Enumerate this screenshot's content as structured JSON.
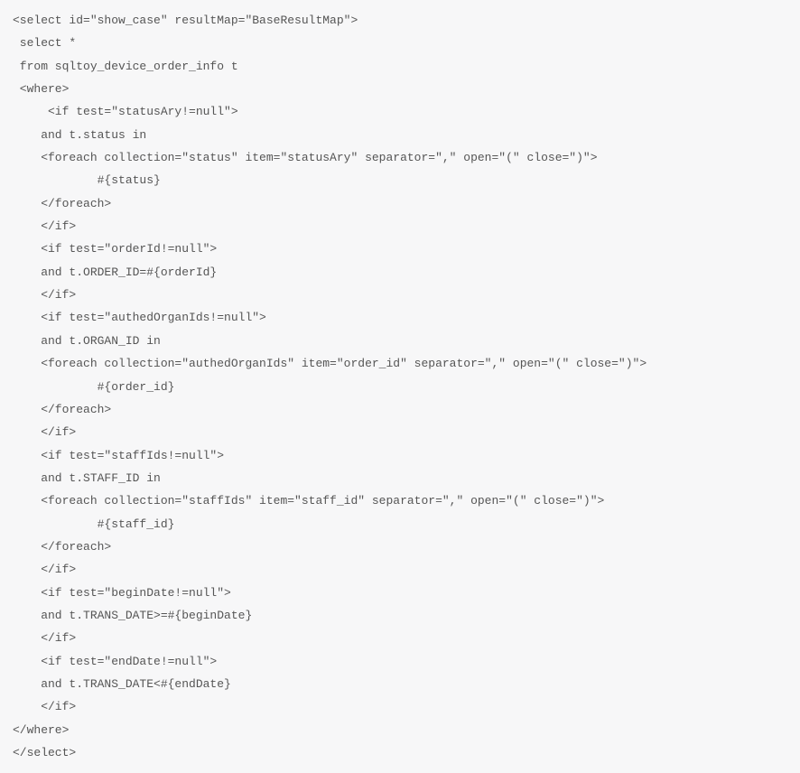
{
  "code_lines": [
    "<select id=\"show_case\" resultMap=\"BaseResultMap\">",
    " select *",
    " from sqltoy_device_order_info t",
    " <where>",
    "     <if test=\"statusAry!=null\">",
    "    and t.status in ",
    "    <foreach collection=\"status\" item=\"statusAry\" separator=\",\" open=\"(\" close=\")\">  ",
    "            #{status}  ",
    "    </foreach>  ",
    "    </if>",
    "    <if test=\"orderId!=null\">",
    "    and t.ORDER_ID=#{orderId}",
    "    </if>",
    "    <if test=\"authedOrganIds!=null\">",
    "    and t.ORGAN_ID in",
    "    <foreach collection=\"authedOrganIds\" item=\"order_id\" separator=\",\" open=\"(\" close=\")\">  ",
    "            #{order_id}  ",
    "    </foreach>  ",
    "    </if>",
    "    <if test=\"staffIds!=null\">",
    "    and t.STAFF_ID in",
    "    <foreach collection=\"staffIds\" item=\"staff_id\" separator=\",\" open=\"(\" close=\")\">  ",
    "            #{staff_id}  ",
    "    </foreach>  ",
    "    </if>",
    "    <if test=\"beginDate!=null\">",
    "    and t.TRANS_DATE>=#{beginDate}",
    "    </if>",
    "    <if test=\"endDate!=null\">",
    "    and t.TRANS_DATE<#{endDate}",
    "    </if>",
    "</where>",
    "</select>"
  ]
}
